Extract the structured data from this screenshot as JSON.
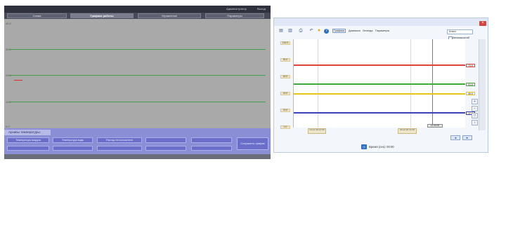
{
  "left_panel": {
    "top_bar": {
      "user": "Администратор",
      "logout": "Выход"
    },
    "tabs": [
      {
        "label": "Схема"
      },
      {
        "label": "Графики работы",
        "active": true
      },
      {
        "label": "Управление"
      },
      {
        "label": "Параметры"
      }
    ],
    "graph": {
      "y_labels": [
        "40.0",
        "30.0",
        "20.0",
        "10.0",
        "0.0"
      ],
      "line_color": "#3f9f4e",
      "marker_color": "#e02a2a"
    },
    "archive": {
      "title": "Архивы температуры:",
      "buttons_row1": [
        "Температура воздуха",
        "Температура воды",
        "Расход теплоносителя",
        "",
        ""
      ],
      "buttons_row2": [
        "",
        "",
        "",
        "",
        ""
      ],
      "save_button": "Сохранить график"
    }
  },
  "right_window": {
    "close_icon": "close-icon",
    "toolbar": {
      "icons": [
        "save-icon",
        "export-icon",
        "print-icon",
        "undo-icon",
        "star-icon",
        "help-icon"
      ],
      "items": [
        "Графики",
        "Диапазон",
        "Легенда",
        "Параметры"
      ],
      "class_select": "Класс",
      "autoscale": "Автомасштаб"
    },
    "chart_data": {
      "type": "line",
      "ylim": [
        0,
        100
      ],
      "y_ticks": [
        "100.0",
        "80.0",
        "60.0",
        "40.0",
        "20.0",
        "0.0"
      ],
      "x_ticks": [
        "23.12.15 12:00",
        "23.12.15 12:20"
      ],
      "cursor_time": "12:30:00",
      "series": [
        {
          "color": "#e0413a",
          "value": 73.5,
          "label": "73.5"
        },
        {
          "color": "#3dab3d",
          "value": 51.0,
          "label": "51.0"
        },
        {
          "color": "#e8c51a",
          "value": 40.0,
          "label": "40.0"
        },
        {
          "color": "#3b3fb8",
          "value": 17.0,
          "label": "17.0"
        }
      ]
    },
    "nav": {
      "prev": "◄",
      "next": "►"
    },
    "status": {
      "text": "Время (сек): 00:00"
    }
  }
}
